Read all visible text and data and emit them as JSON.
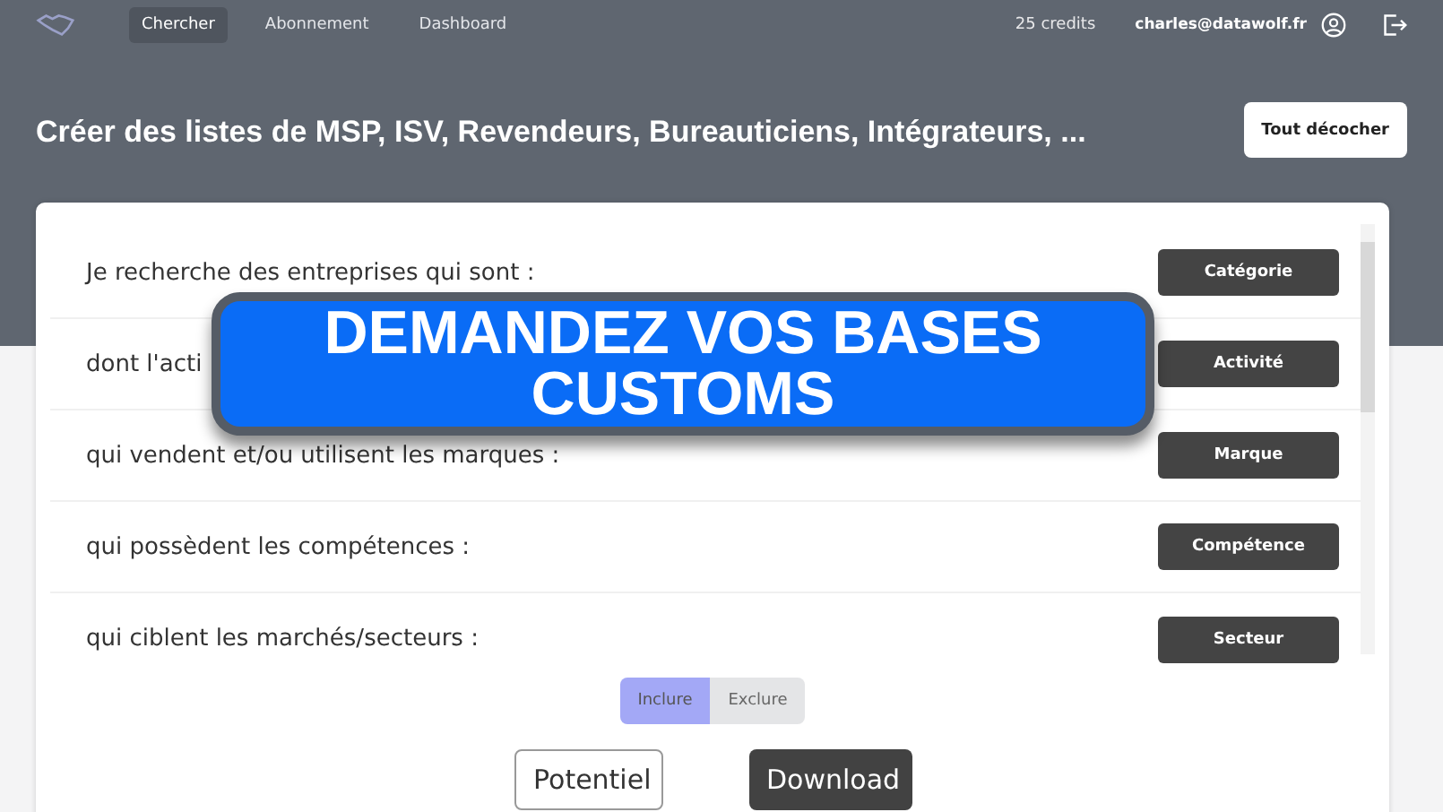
{
  "nav": {
    "tabs": [
      {
        "label": "Chercher",
        "selected": true
      },
      {
        "label": "Abonnement",
        "selected": false
      },
      {
        "label": "Dashboard",
        "selected": false
      }
    ],
    "credits": "25 credits",
    "email": "charles@datawolf.fr"
  },
  "header": {
    "title": "Créer des listes de MSP, ISV, Revendeurs, Bureauticiens, Intégrateurs, ...",
    "button": "Tout décocher"
  },
  "criteria": [
    {
      "label": "Je recherche des entreprises qui sont :",
      "button": "Catégorie"
    },
    {
      "label": "dont l'acti",
      "button": "Activité"
    },
    {
      "label": "qui vendent et/ou utilisent les marques :",
      "button": "Marque"
    },
    {
      "label": "qui possèdent les compétences :",
      "button": "Compétence"
    },
    {
      "label": "qui ciblent les marchés/secteurs :",
      "button": "Secteur"
    }
  ],
  "mode": [
    {
      "label": "Inclure",
      "selected": true
    },
    {
      "label": "Exclure",
      "selected": false
    }
  ],
  "actions": [
    {
      "label": "Potentiel",
      "kind": "outline"
    },
    {
      "label": "Download",
      "kind": "solid"
    }
  ],
  "banner": {
    "lines": [
      "DEMANDEZ VOS BASES",
      "CUSTOMS"
    ]
  }
}
